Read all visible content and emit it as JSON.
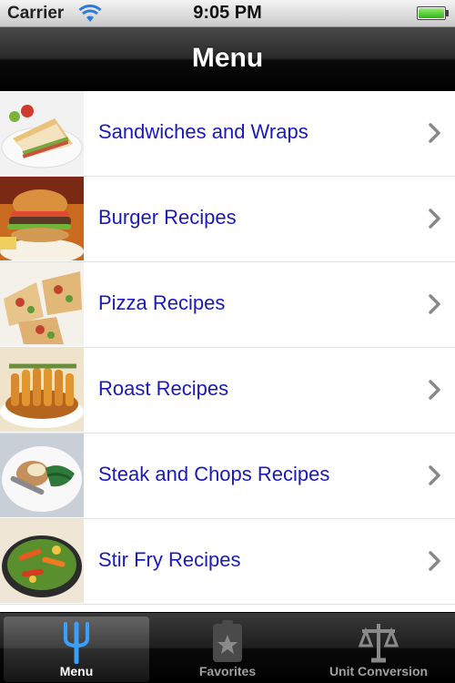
{
  "status_bar": {
    "carrier": "Carrier",
    "time": "9:05 PM",
    "icons": [
      "wifi-icon",
      "battery-icon"
    ]
  },
  "nav": {
    "title": "Menu"
  },
  "list": {
    "items": [
      {
        "label": "Sandwiches and Wraps",
        "thumb": "sandwich-thumbnail"
      },
      {
        "label": "Burger Recipes",
        "thumb": "burger-thumbnail"
      },
      {
        "label": "Pizza Recipes",
        "thumb": "pizza-thumbnail"
      },
      {
        "label": "Roast Recipes",
        "thumb": "roast-thumbnail"
      },
      {
        "label": "Steak and Chops Recipes",
        "thumb": "steak-thumbnail"
      },
      {
        "label": "Stir Fry Recipes",
        "thumb": "stirfry-thumbnail"
      }
    ],
    "accessory": "chevron-right-icon"
  },
  "tabbar": {
    "tabs": [
      {
        "label": "Menu",
        "icon": "fork-icon",
        "selected": true
      },
      {
        "label": "Favorites",
        "icon": "star-icon",
        "selected": false
      },
      {
        "label": "Unit Conversion",
        "icon": "scale-icon",
        "selected": false
      }
    ]
  },
  "colors": {
    "link_blue": "#1a1ab8",
    "tab_selected_icon": "#3aa0ff"
  }
}
